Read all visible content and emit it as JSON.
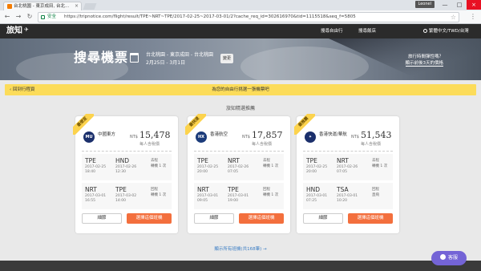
{
  "browser": {
    "tab_title": "台北桃園 - 東京成田, 台北...",
    "tab_close": "×",
    "user_badge": "Leonel",
    "secure_label": "安全",
    "url": "https://tripnotice.com/flight/result/TPE~NRT~TPE/2017-02-25~2017-03-01/2?cache_req_id=302616970&tid=1115518&seq_f=5805",
    "win_min": "—",
    "win_max": "□",
    "win_close": "×",
    "back": "←",
    "forward": "→",
    "reload": "↻",
    "menu": "⋮"
  },
  "site": {
    "logo": "旅知",
    "nav": [
      "搜尋自由行",
      "搜尋飯店"
    ],
    "locale": "繁體中文/TWD/台灣"
  },
  "hero": {
    "title": "搜尋機票",
    "route": "台北桃園 - 東京成田 - 台北桃園",
    "dates": "2月25日 - 3月1日",
    "change_label": "變更",
    "travel_question": "旅行時間彈性嗎？",
    "travel_sub": "顯示前後3天的價格"
  },
  "banner": {
    "back_label": "回到行程頁",
    "text": "為您的自由行挑選一張機票吧"
  },
  "recommend_title": "旅知精選推薦",
  "cards": [
    {
      "badge": "最便宜",
      "logo_text": "MU",
      "logo_color": "#1b2f6b",
      "airline": "中國東方",
      "currency": "NT$",
      "price": "15,478",
      "per_person": "每人含稅價",
      "segments": [
        {
          "from": "TPE",
          "from_time": "2017-02-25 18:40",
          "to": "HND",
          "to_time": "2017-02-26 12:30",
          "dir": "去程",
          "stops": "轉機 1 次"
        },
        {
          "from": "NRT",
          "from_time": "2017-03-01 16:55",
          "to": "TPE",
          "to_time": "2017-03-02 14:00",
          "dir": "回程",
          "stops": "轉機 1 次"
        }
      ],
      "detail_label": "細節",
      "select_label": "選擇這個班機"
    },
    {
      "badge": "最快速",
      "logo_text": "HX",
      "logo_color": "#1b3b7a",
      "airline": "香港航空",
      "currency": "NT$",
      "price": "17,857",
      "per_person": "每人含稅價",
      "segments": [
        {
          "from": "TPE",
          "from_time": "2017-02-25 20:00",
          "to": "NRT",
          "to_time": "2017-02-26 07:05",
          "dir": "去程",
          "stops": "轉機 1 次"
        },
        {
          "from": "NRT",
          "from_time": "2017-03-01 09:05",
          "to": "TPE",
          "to_time": "2017-03-01 19:00",
          "dir": "回程",
          "stops": "轉機 1 次"
        }
      ],
      "detail_label": "細節",
      "select_label": "選擇這個班機"
    },
    {
      "badge": "最推薦",
      "logo_text": "✦",
      "logo_color": "#1b2f6b",
      "airline": "香港快運/華航",
      "currency": "NT$",
      "price": "51,543",
      "per_person": "每人含稅價",
      "segments": [
        {
          "from": "TPE",
          "from_time": "2017-02-25 20:00",
          "to": "NRT",
          "to_time": "2017-02-26 07:05",
          "dir": "去程",
          "stops": "轉機 1 次"
        },
        {
          "from": "HND",
          "from_time": "2017-03-01 07:25",
          "to": "TSA",
          "to_time": "2017-03-01 10:20",
          "dir": "回程",
          "stops": "直飛"
        }
      ],
      "detail_label": "細節",
      "select_label": "選擇這個班機"
    }
  ],
  "show_all": "顯示所有班機(共168筆) →",
  "chat_label": "客服"
}
